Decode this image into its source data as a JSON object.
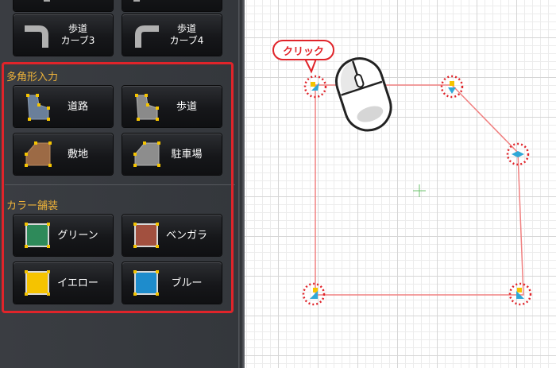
{
  "top_row": [
    {
      "label": "",
      "icon": "sidewalk-straight-icon"
    },
    {
      "label": "",
      "icon": "sidewalk-straight-icon"
    }
  ],
  "curve_row": [
    {
      "label": "歩道\nカーブ3",
      "icon": "sidewalk-curve3-icon"
    },
    {
      "label": "歩道\nカーブ4",
      "icon": "sidewalk-curve4-icon"
    }
  ],
  "polygon_section": {
    "title": "多角形入力",
    "buttons": [
      {
        "label": "道路",
        "icon": "road-polygon-icon"
      },
      {
        "label": "歩道",
        "icon": "sidewalk-polygon-icon"
      },
      {
        "label": "敷地",
        "icon": "lot-polygon-icon"
      },
      {
        "label": "駐車場",
        "icon": "parking-polygon-icon"
      }
    ]
  },
  "color_section": {
    "title": "カラー舗装",
    "buttons": [
      {
        "label": "グリーン",
        "icon": "green-paving-icon",
        "color": "#2e8a5a"
      },
      {
        "label": "ベンガラ",
        "icon": "bengara-paving-icon",
        "color": "#a2503f"
      },
      {
        "label": "イエロー",
        "icon": "yellow-paving-icon",
        "color": "#f5c300"
      },
      {
        "label": "ブルー",
        "icon": "blue-paving-icon",
        "color": "#1e8ccc"
      }
    ]
  },
  "canvas": {
    "callout_text": "クリック",
    "polygon_color": "#f08080",
    "highlight_color": "#e0242a"
  }
}
